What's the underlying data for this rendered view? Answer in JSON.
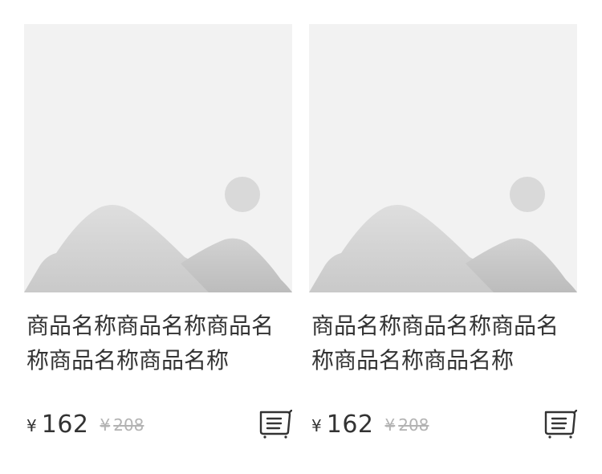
{
  "products": [
    {
      "image_icon": "placeholder-image-mountain-sun",
      "title": "商品名称商品名称商品名称商品名称商品名称",
      "currency": "¥",
      "price": "162",
      "original_currency": "¥",
      "original_price": "208",
      "cart_icon": "cart-icon"
    },
    {
      "image_icon": "placeholder-image-mountain-sun",
      "title": "商品名称商品名称商品名称商品名称商品名称",
      "currency": "¥",
      "price": "162",
      "original_currency": "¥",
      "original_price": "208",
      "cart_icon": "cart-icon"
    }
  ],
  "colors": {
    "placeholder_bg": "#f2f2f2",
    "placeholder_shape": "#d6d6d6",
    "text": "#333333",
    "muted": "#b3b3b3"
  }
}
